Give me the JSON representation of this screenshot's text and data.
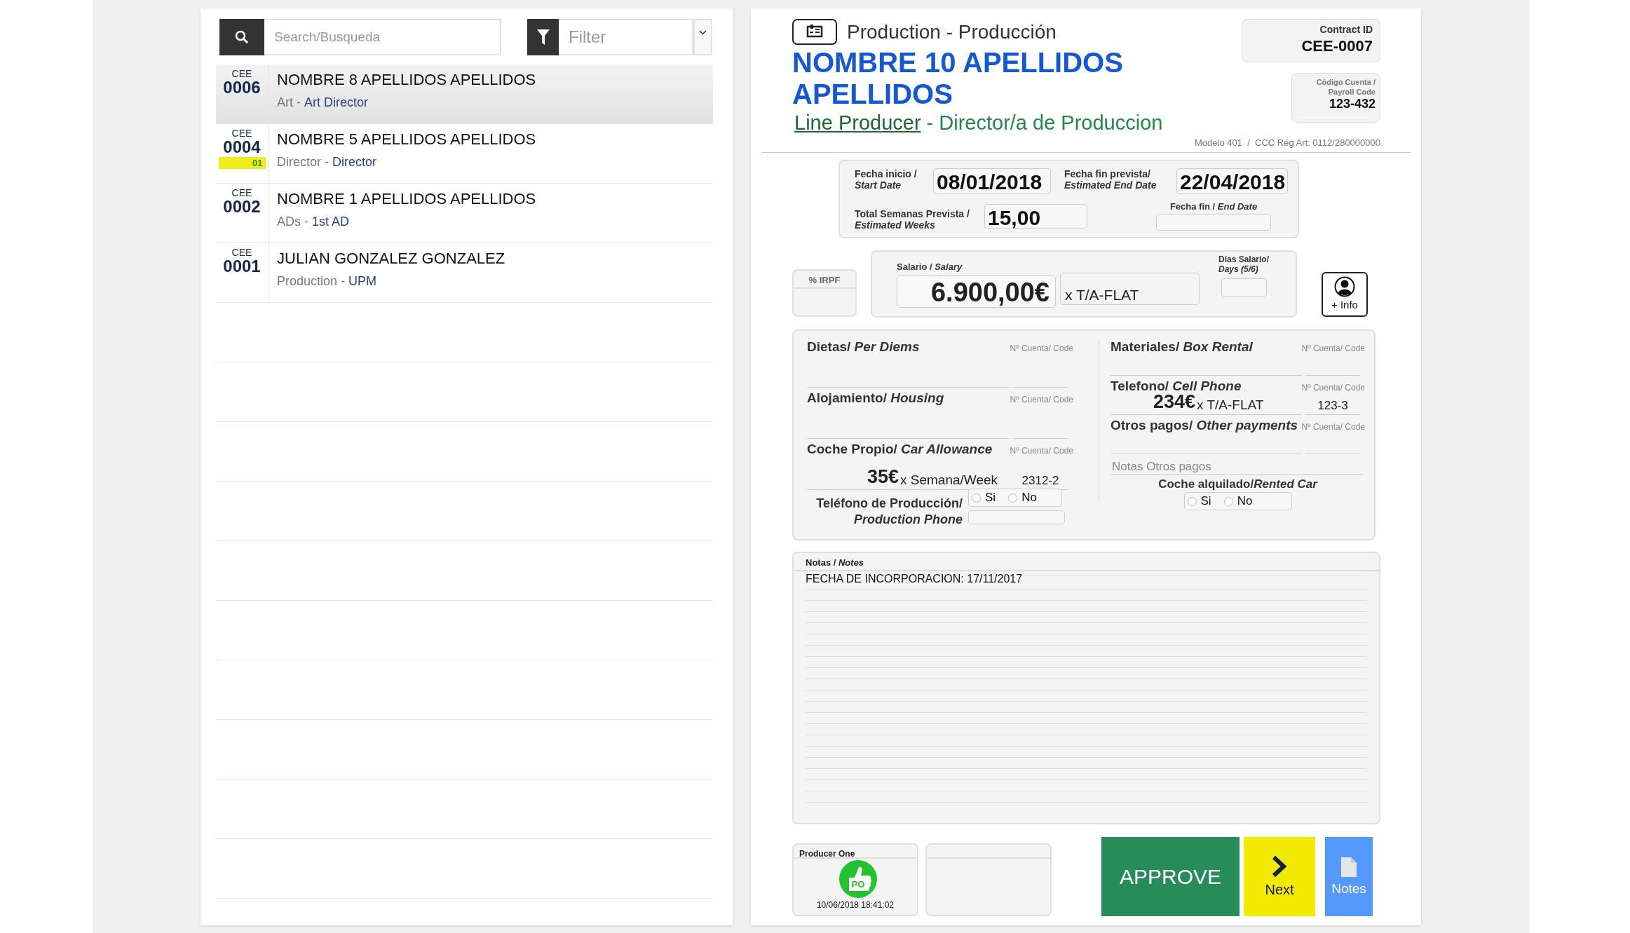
{
  "search": {
    "placeholder": "Search/Busqueda"
  },
  "filter": {
    "placeholder": "Filter"
  },
  "employees": [
    {
      "prefix": "CEE",
      "code": "0006",
      "name": "NOMBRE 8 APELLIDOS APELLIDOS",
      "department": "Art -",
      "role": "Art Director",
      "selected": true
    },
    {
      "prefix": "CEE",
      "code": "0004",
      "badge": "01",
      "name": "NOMBRE 5 APELLIDOS APELLIDOS",
      "department": "Director -",
      "role": "Director",
      "selected": false
    },
    {
      "prefix": "CEE",
      "code": "0002",
      "name": "NOMBRE 1 APELLIDOS APELLIDOS",
      "department": "ADs -",
      "role": "1st AD",
      "selected": false
    },
    {
      "prefix": "CEE",
      "code": "0001",
      "name": "JULIAN GONZALEZ GONZALEZ",
      "department": "Production -",
      "role": "UPM",
      "selected": false
    }
  ],
  "contract": {
    "department": "Production - Producción",
    "name": "NOMBRE 10 APELLIDOS APELLIDOS",
    "role_link": "Line Producer",
    "role_rest": "- Director/a de Produccion",
    "contract_id_label": "Contract ID",
    "contract_id": "CEE-0007",
    "payroll_label": "Código Cuenta / Payroll Code",
    "payroll_code": "123-432",
    "modelo": "Modelo 401  /  CCC Rég Art: 0112/280000000"
  },
  "dates": {
    "start_label": "Fecha inicio /",
    "start_label_en": "Start Date",
    "start": "08/01/2018",
    "end_label": "Fecha fin prevista/",
    "end_label_en": "Estimated End Date",
    "end": "22/04/2018",
    "weeks_label": "Total Semanas Prevista /",
    "weeks_label_en": "Estimated Weeks",
    "weeks": "15,00",
    "end_date_label": "Fecha fin  / *End Date*"
  },
  "irpf": {
    "label": "% IRPF"
  },
  "salary": {
    "label": "Salario / *Salary*",
    "amount": "6.900,00€",
    "unit": "x T/A-FLAT",
    "days_label": "Días Salario/",
    "days_label_en": "Days (5/6)"
  },
  "info_button": {
    "label": "+ Info"
  },
  "expenses_left": [
    {
      "title": "Dietas/ *Per Diems*",
      "code_label": "Nº Cuenta/ Code"
    },
    {
      "title": "Alojamiento/ *Housing*",
      "code_label": "Nº Cuenta/ Code"
    },
    {
      "title": "Coche Propio/ *Car Allowance*",
      "code_label": "Nº Cuenta/ Code",
      "amount": "35€",
      "unit": "x Semana/Week",
      "code": "2312-2"
    }
  ],
  "expenses_right": [
    {
      "title": "Materiales/ *Box Rental*",
      "code_label": "Nº Cuenta/ Code"
    },
    {
      "title": "Telefono/ *Cell Phone*",
      "code_label": "Nº Cuenta/ Code",
      "amount": "234€",
      "unit": "x T/A-FLAT",
      "code": "123-3"
    },
    {
      "title": "Otros pagos/ *Other payments*",
      "code_label": "Nº Cuenta/ Code"
    }
  ],
  "production_phone": {
    "label": "Teléfono de Producción/",
    "label_en": "Production Phone",
    "options": [
      {
        "label": "Si",
        "selected": false
      },
      {
        "label": "No",
        "selected": false
      }
    ]
  },
  "other_notes": {
    "placeholder": "Notas Otros pagos"
  },
  "rented_car": {
    "label": "Coche alquilado/*Rented Car*",
    "options": [
      {
        "label": "Si",
        "selected": false
      },
      {
        "label": "No",
        "selected": false
      }
    ]
  },
  "notes": {
    "label": "Notas / *Notes*",
    "text": "FECHA DE INCORPORACION: 17/11/2017"
  },
  "signatures": [
    {
      "kind": "signed",
      "name": "Producer One",
      "stamp": "PO",
      "date": "10/06/2018 18:41:02"
    },
    {
      "kind": "empty"
    }
  ],
  "actions": [
    {
      "kind": "approve",
      "label": "APPROVE"
    },
    {
      "kind": "next",
      "label": "Next"
    },
    {
      "kind": "notes",
      "label": "Notes"
    }
  ]
}
